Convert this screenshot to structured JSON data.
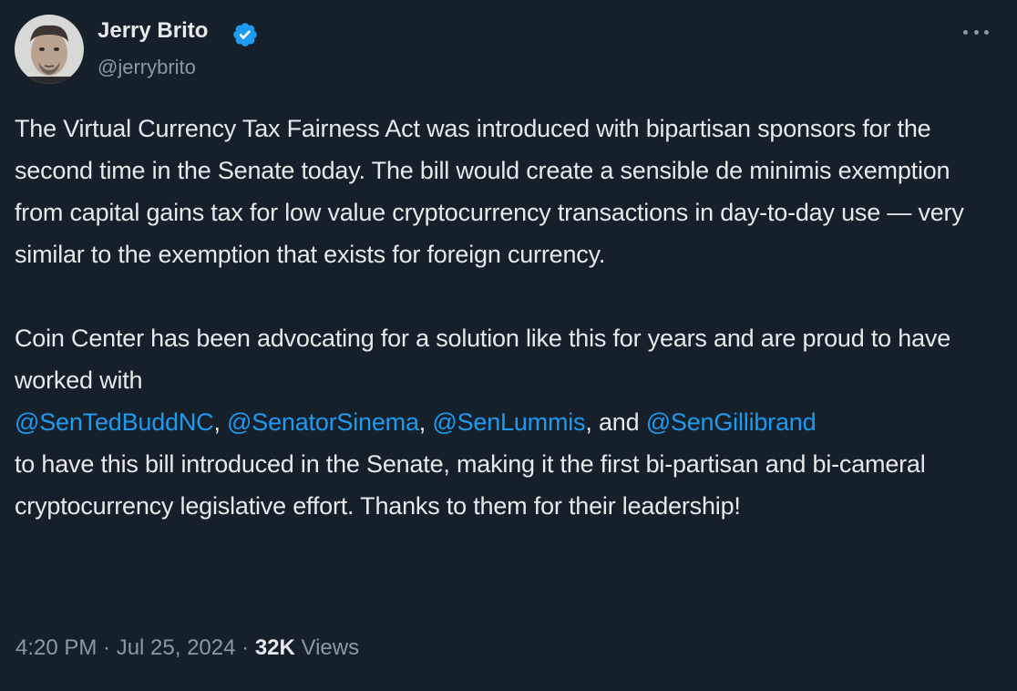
{
  "author": {
    "name": "Jerry Brito",
    "handle": "@jerrybrito",
    "verified": true,
    "avatar_icon": "profile-photo"
  },
  "colors": {
    "background": "#15202b",
    "text": "#e7e9ea",
    "muted": "#8b98a5",
    "link": "#1d9bf0",
    "verified": "#1d9bf0"
  },
  "tweet": {
    "paragraph1": "The Virtual Currency Tax Fairness Act was introduced with bipartisan sponsors for the second time in the Senate today. The bill would create a sensible de minimis exemption from capital gains tax for low value cryptocurrency transactions in day-to-day use — very similar to the exemption that exists for foreign currency.",
    "paragraph2_intro": "Coin Center has been advocating for a solution like this for years and are proud to have worked with",
    "mentions": [
      "@SenTedBuddNC",
      "@SenatorSinema",
      "@SenLummis",
      "@SenGillibrand"
    ],
    "sep1": ", ",
    "sep2": ", ",
    "sep3": ", and ",
    "paragraph2_outro": "to have this bill introduced in the Senate, making it the first bi-partisan and bi-cameral cryptocurrency legislative effort. Thanks to them for their leadership!"
  },
  "meta": {
    "time": "4:20 PM · Jul 25, 2024",
    "separator": " · ",
    "views_count": "32K",
    "views_label": " Views"
  }
}
